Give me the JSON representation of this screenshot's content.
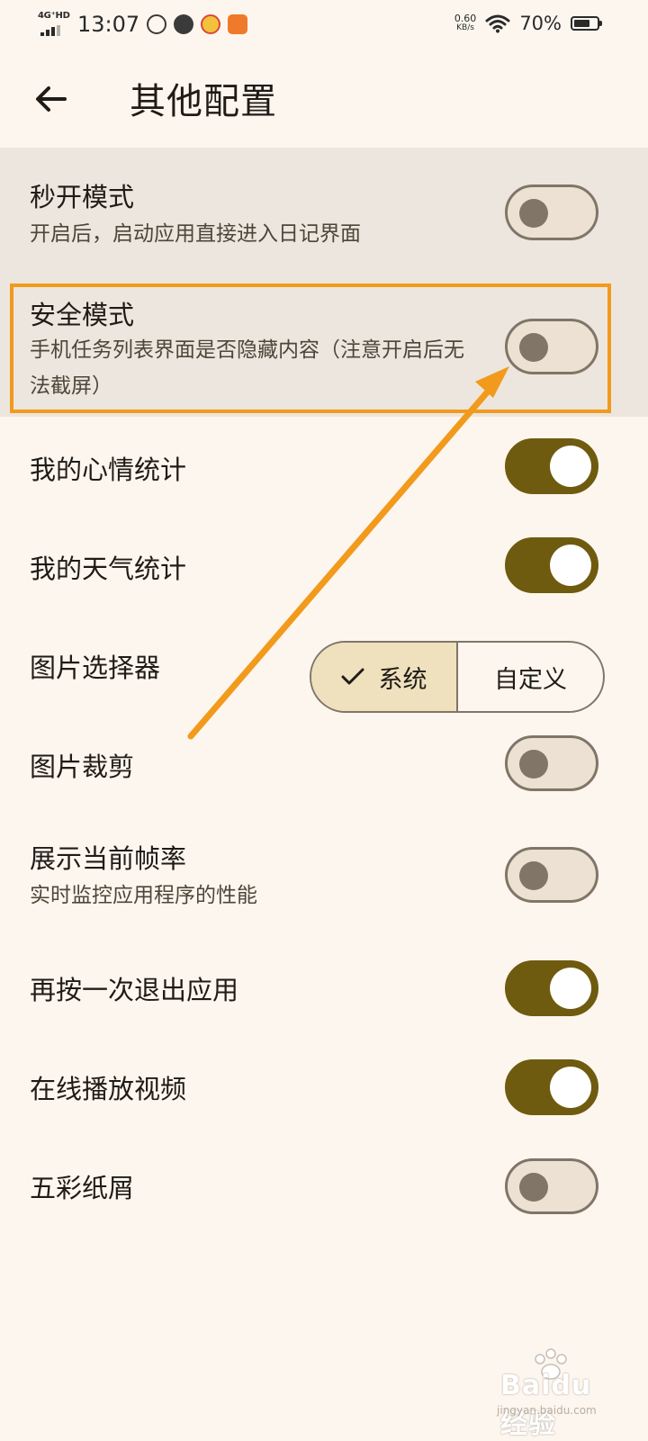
{
  "status_bar": {
    "network": "4G⁺HD",
    "time": "13:07",
    "net_speed_value": "0.60",
    "net_speed_unit": "KB/s",
    "battery_percent": "70%",
    "battery_level": 0.7
  },
  "app_bar": {
    "title": "其他配置",
    "back_icon": "arrow-back-icon"
  },
  "settings": [
    {
      "title": "秒开模式",
      "subtitle": "开启后，启动应用直接进入日记界面",
      "state": "off"
    },
    {
      "title": "安全模式",
      "subtitle": "手机任务列表界面是否隐藏内容（注意开启后无法截屏）",
      "state": "off"
    },
    {
      "title": "我的心情统计",
      "state": "on"
    },
    {
      "title": "我的天气统计",
      "state": "on"
    },
    {
      "title": "图片选择器",
      "options": [
        "系统",
        "自定义"
      ],
      "selected": "系统"
    },
    {
      "title": "图片裁剪",
      "state": "off"
    },
    {
      "title": "展示当前帧率",
      "subtitle": "实时监控应用程序的性能",
      "state": "off"
    },
    {
      "title": "再按一次退出应用",
      "state": "on"
    },
    {
      "title": "在线播放视频",
      "state": "on"
    },
    {
      "title": "五彩纸屑",
      "state": "off"
    }
  ],
  "watermark": {
    "brand": "Baidu经验",
    "url": "jingyan.baidu.com"
  },
  "colors": {
    "background": "#fdf6ee",
    "switch_on": "#6f5b0f",
    "switch_off_outline": "#807567",
    "segment_selected": "#efe1be",
    "highlight_annotation": "#f29a1c"
  }
}
